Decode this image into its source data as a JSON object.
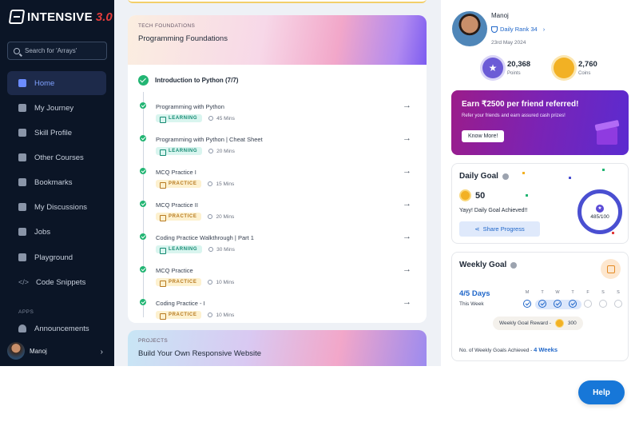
{
  "brand": {
    "name": "INTENSIVE",
    "version": "3.0"
  },
  "search": {
    "placeholder": "Search for 'Arrays'"
  },
  "nav": {
    "items": [
      {
        "label": "Home",
        "icon": "home-icon"
      },
      {
        "label": "My Journey",
        "icon": "journey-icon"
      },
      {
        "label": "Skill Profile",
        "icon": "skill-profile-icon"
      },
      {
        "label": "Other Courses",
        "icon": "courses-icon"
      },
      {
        "label": "Bookmarks",
        "icon": "bookmark-icon"
      },
      {
        "label": "My Discussions",
        "icon": "discussions-icon"
      },
      {
        "label": "Jobs",
        "icon": "jobs-icon"
      },
      {
        "label": "Playground",
        "icon": "playground-icon"
      },
      {
        "label": "Code Snippets",
        "icon": "code-icon"
      }
    ],
    "apps_label": "APPS",
    "announcements": "Announcements",
    "user": "Manoj"
  },
  "section": {
    "kicker": "TECH FOUNDATIONS",
    "title": "Programming Foundations",
    "topic": "Introduction to Python (7/7)",
    "lessons": [
      {
        "title": "Programming with Python",
        "type": "LEARNING",
        "duration": "45 Mins"
      },
      {
        "title": "Programming with Python | Cheat Sheet",
        "type": "LEARNING",
        "duration": "20 Mins"
      },
      {
        "title": "MCQ Practice I",
        "type": "PRACTICE",
        "duration": "15 Mins"
      },
      {
        "title": "MCQ Practice II",
        "type": "PRACTICE",
        "duration": "20 Mins"
      },
      {
        "title": "Coding Practice Walkthrough | Part 1",
        "type": "LEARNING",
        "duration": "30 Mins"
      },
      {
        "title": "MCQ Practice",
        "type": "PRACTICE",
        "duration": "10 Mins"
      },
      {
        "title": "Coding Practice - I",
        "type": "PRACTICE",
        "duration": "10 Mins"
      }
    ]
  },
  "projects": {
    "kicker": "PROJECTS",
    "title": "Build Your Own Responsive Website"
  },
  "profile": {
    "name": "Manoj",
    "rank": "Daily Rank 34",
    "date": "23rd May 2024",
    "points": "20,368",
    "points_label": "Points",
    "coins": "2,760",
    "coins_label": "Coins"
  },
  "referral": {
    "title": "Earn ₹2500 per friend referred!",
    "subtitle": "Refer your friends and earn assured cash prizes!",
    "button": "Know More!"
  },
  "daily_goal": {
    "title": "Daily Goal",
    "value": "50",
    "message": "Yayy! Daily Goal Achieved!!",
    "share": "Share Progress",
    "progress": "485/100"
  },
  "weekly_goal": {
    "title": "Weekly Goal",
    "days": "4/5 Days",
    "sub": "This Week",
    "week": [
      {
        "d": "M",
        "done": true
      },
      {
        "d": "T",
        "done": true
      },
      {
        "d": "W",
        "done": true
      },
      {
        "d": "T",
        "done": true
      },
      {
        "d": "F",
        "done": false
      },
      {
        "d": "S",
        "done": false
      },
      {
        "d": "S",
        "done": false
      }
    ],
    "reward_label": "Weekly Goal Reward -",
    "reward_value": "300",
    "count_label": "No. of Weekly Goals Achieved -",
    "count_value": "4 Weeks"
  },
  "help": {
    "label": "Help"
  },
  "colors": {
    "accent": "#1f66c9",
    "sidebar": "#0b1526",
    "success": "#22b573"
  }
}
